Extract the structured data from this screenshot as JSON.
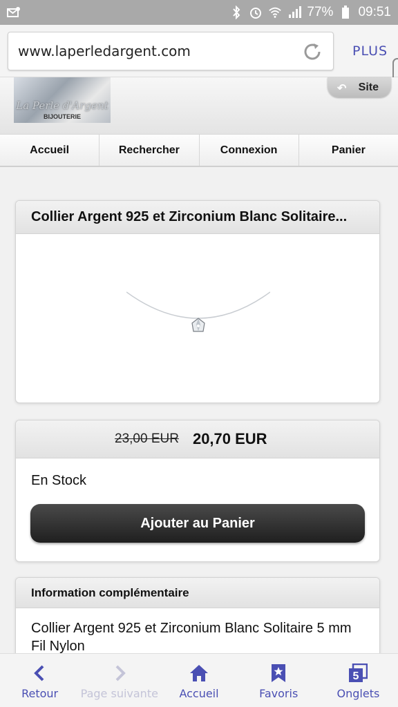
{
  "status_bar": {
    "battery": "77%",
    "time": "09:51"
  },
  "browser": {
    "url": "www.laperledargent.com",
    "menu_label": "PLUS"
  },
  "site": {
    "logo_title": "La Perle d'Argent",
    "logo_subtitle": "BIJOUTERIE",
    "site_button": "Site"
  },
  "nav": {
    "items": [
      "Accueil",
      "Rechercher",
      "Connexion",
      "Panier"
    ]
  },
  "product": {
    "title": "Collier Argent 925 et Zirconium Blanc Solitaire..."
  },
  "pricing": {
    "old_price": "23,00 EUR",
    "new_price": "20,70 EUR",
    "stock": "En Stock",
    "add_to_cart": "Ajouter au Panier"
  },
  "info": {
    "header": "Information complémentaire",
    "text": "Collier Argent 925 et Zirconium Blanc Solitaire 5 mm Fil Nylon"
  },
  "bottom_bar": {
    "items": [
      {
        "label": "Retour",
        "icon": "chevron-left-icon"
      },
      {
        "label": "Page suivante",
        "icon": "chevron-right-icon"
      },
      {
        "label": "Accueil",
        "icon": "home-icon"
      },
      {
        "label": "Favoris",
        "icon": "bookmark-star-icon"
      },
      {
        "label": "Onglets",
        "icon": "tabs-icon",
        "count": "5"
      }
    ]
  },
  "colors": {
    "accent": "#4a4fb3",
    "status_bar": "#a9a9a9",
    "button_dark": "#2a2a2a"
  }
}
